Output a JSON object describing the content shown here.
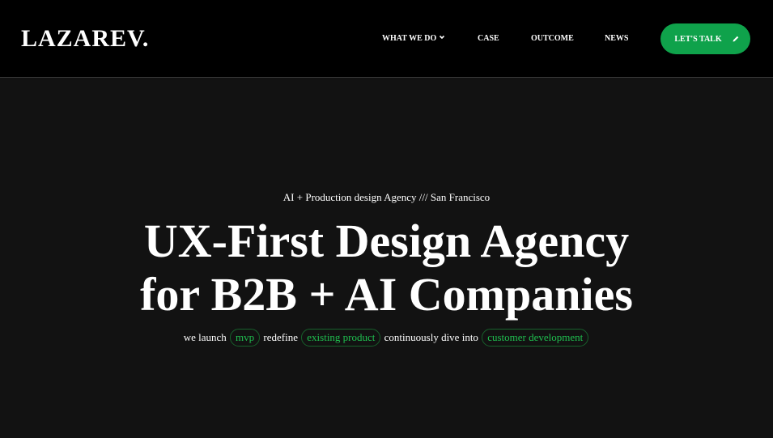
{
  "header": {
    "logo": "LAZAREV.",
    "nav": [
      {
        "label": "WHAT WE DO",
        "has_dropdown": true
      },
      {
        "label": "CASE"
      },
      {
        "label": "OUTCOME"
      },
      {
        "label": "NEWS"
      }
    ],
    "cta": {
      "label": "LET'S TALK",
      "icon": "pencil-icon",
      "color": "#0fa24b"
    }
  },
  "hero": {
    "subtitle": "AI + Production design Agency /// San Francisco",
    "headline_line1": "UX-First Design Agency",
    "headline_line2": "for B2B + AI Companies",
    "tagline": {
      "part1": "we launch",
      "pill1": "mvp",
      "part2": "redefine",
      "pill2": "existing product",
      "part3": "continuously dive into",
      "pill3": "customer development"
    },
    "pill_color": "#1fbf4f"
  },
  "colors": {
    "header_bg": "#000000",
    "page_bg": "#121212",
    "accent": "#0fa24b"
  }
}
